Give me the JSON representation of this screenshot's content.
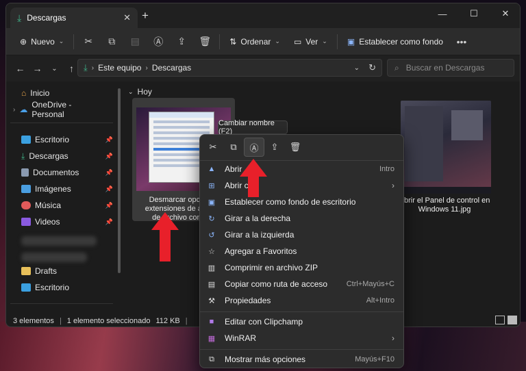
{
  "window": {
    "tab_title": "Descargas",
    "close_tab": "✕",
    "new_tab": "+"
  },
  "controls": {
    "minimize": "—",
    "maximize": "☐",
    "close": "✕"
  },
  "toolbar": {
    "new_label": "Nuevo",
    "sort_label": "Ordenar",
    "view_label": "Ver",
    "set_background_label": "Establecer como fondo",
    "more": "•••"
  },
  "address": {
    "crumbs": [
      "Este equipo",
      "Descargas"
    ],
    "search_placeholder": "Buscar en Descargas"
  },
  "sidebar": {
    "home": "Inicio",
    "onedrive": "OneDrive - Personal",
    "items": [
      "Escritorio",
      "Descargas",
      "Documentos",
      "Imágenes",
      "Música",
      "Videos"
    ],
    "drafts": "Drafts",
    "desktop2": "Escritorio"
  },
  "content": {
    "group": "Hoy",
    "file1_label": "Desmarcar opcion Ocultar extensiones de archivo para tipos de archivo conocidos",
    "file1_visible_lines": [
      "Desmarcar opcion O",
      "extensiones de archivo",
      "de archivo conocio"
    ],
    "file3_lines": [
      "Abrir el Panel de control en",
      "Windows 11.jpg"
    ]
  },
  "status": {
    "count": "3 elementos",
    "selection": "1 elemento seleccionado",
    "size": "112 KB"
  },
  "tooltip": "Cambiar nombre (F2)",
  "context_menu": {
    "items": [
      {
        "label": "Abrir",
        "accel": "Intro"
      },
      {
        "label": "Abrir con",
        "accel": ""
      },
      {
        "label": "Establecer como fondo de escritorio",
        "accel": ""
      },
      {
        "label": "Girar a la derecha",
        "accel": ""
      },
      {
        "label": "Girar a la izquierda",
        "accel": ""
      },
      {
        "label": "Agregar a Favoritos",
        "accel": ""
      },
      {
        "label": "Comprimir en archivo ZIP",
        "accel": ""
      },
      {
        "label": "Copiar como ruta de acceso",
        "accel": "Ctrl+Mayús+C"
      },
      {
        "label": "Propiedades",
        "accel": "Alt+Intro"
      },
      {
        "label": "Editar con Clipchamp",
        "accel": ""
      },
      {
        "label": "WinRAR",
        "accel": ""
      },
      {
        "label": "Mostrar más opciones",
        "accel": "Mayús+F10"
      }
    ]
  },
  "colors": {
    "accent_arrow": "#e8202a",
    "download_green": "#3fb58a"
  }
}
